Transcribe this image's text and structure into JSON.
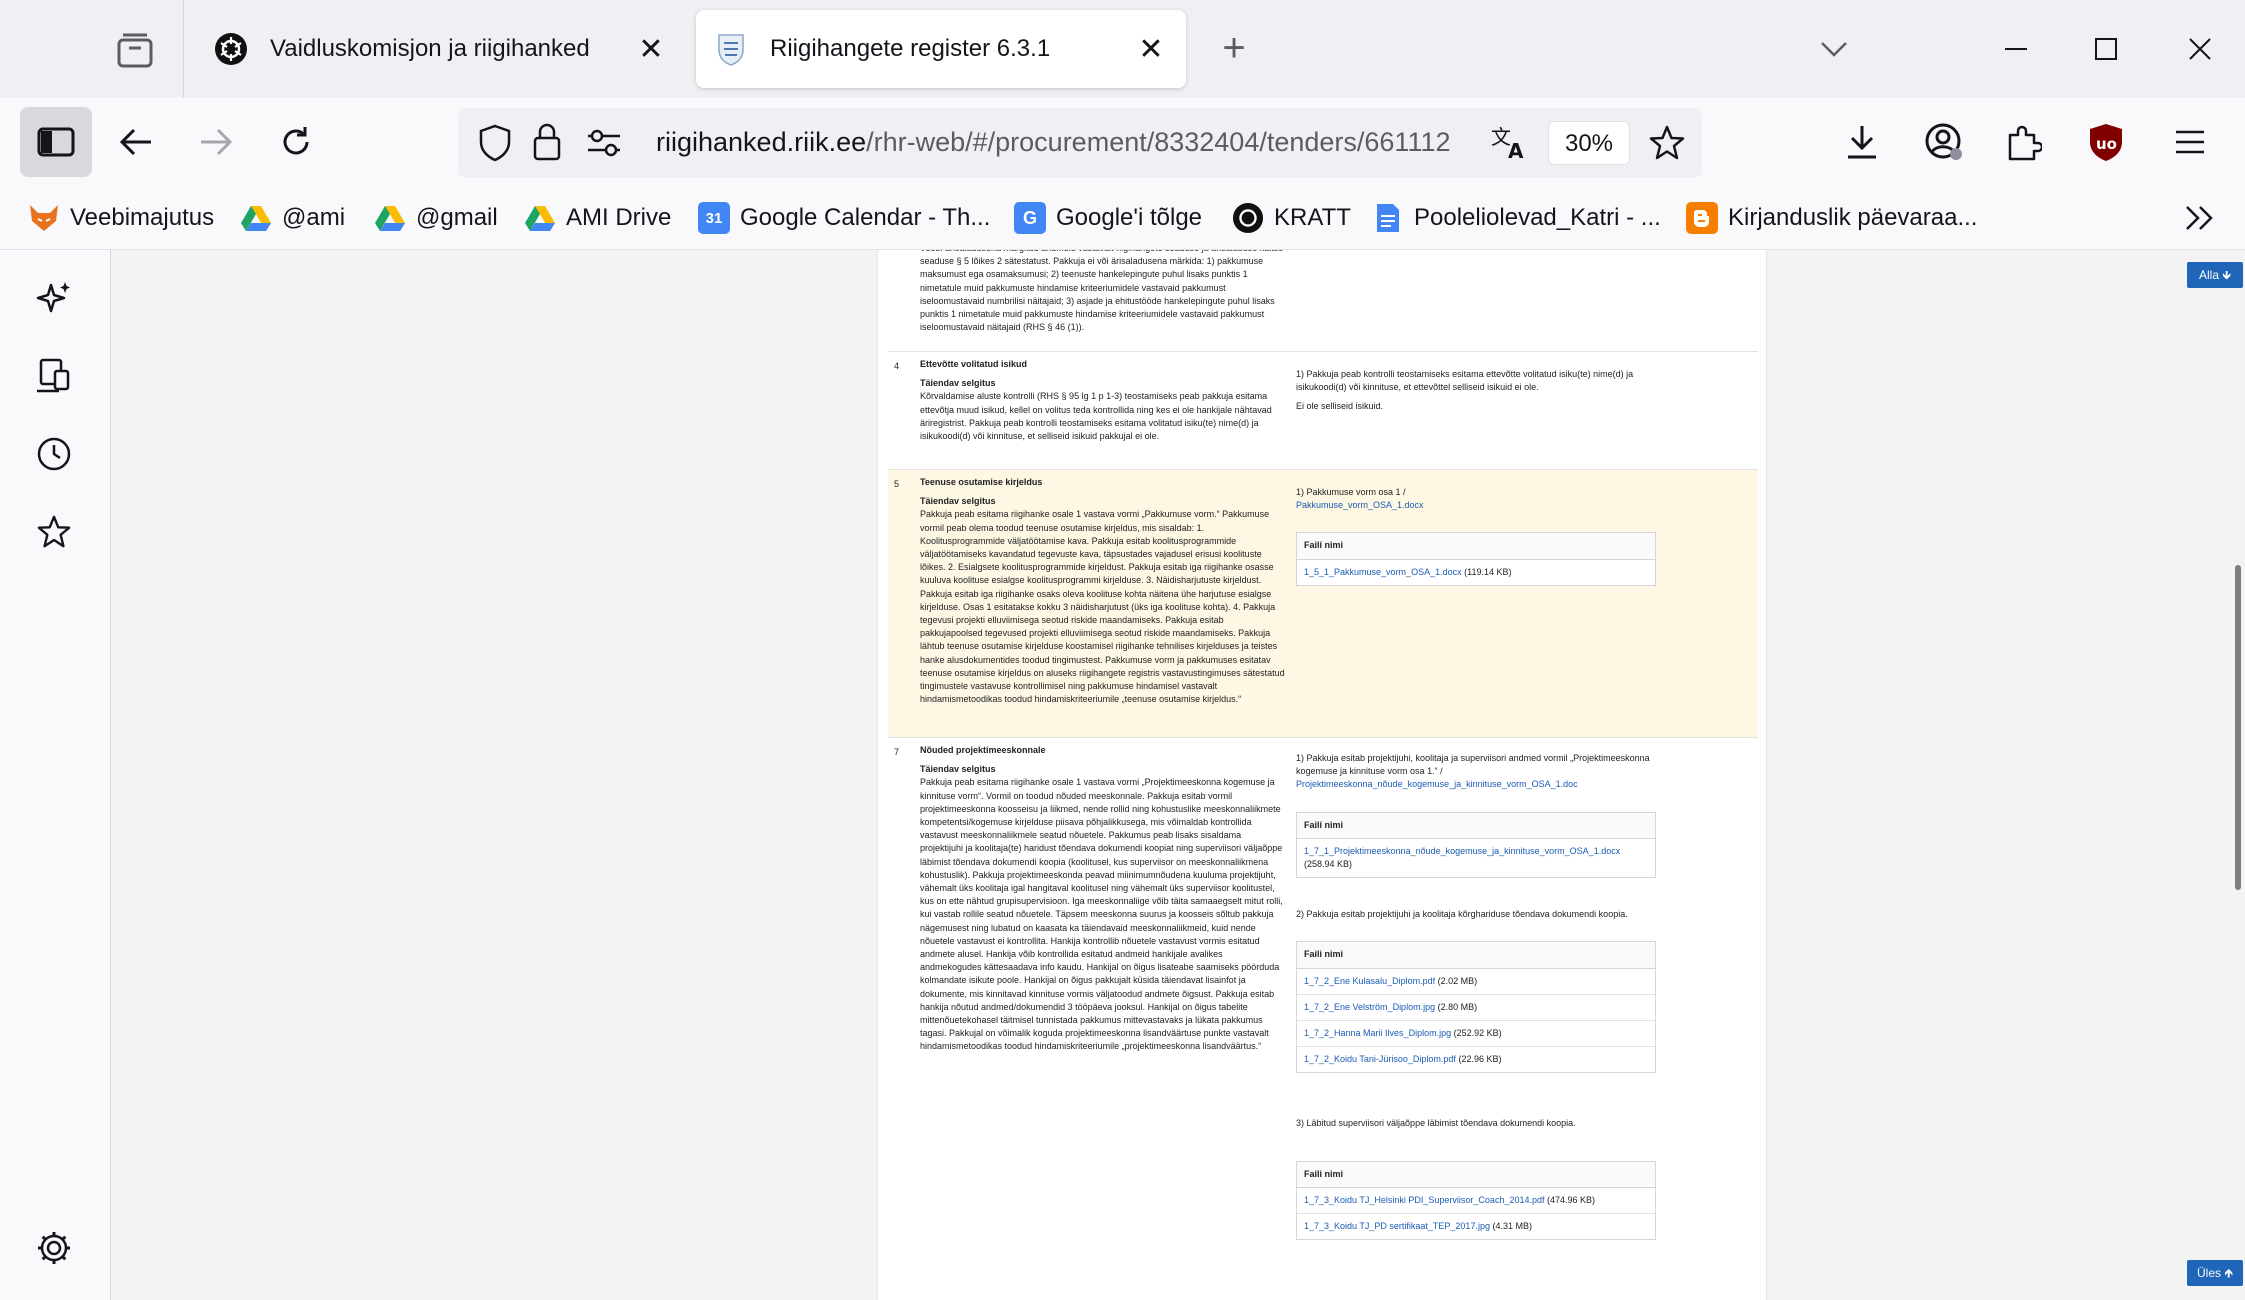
{
  "tabs": [
    {
      "title": "Vaidluskomisjon ja riigihanked",
      "icon": "openai-icon"
    },
    {
      "title": "Riigihangete register 6.3.1",
      "icon": "estonia-coat-of-arms-icon"
    }
  ],
  "urlbar": {
    "host": "riigihanked.riik.ee",
    "path": "/rhr-web/#/procurement/8332404/tenders/661112",
    "zoom": "30%"
  },
  "bookmarks": [
    {
      "label": "Veebimajutus",
      "icon": "fox-icon",
      "color": "#e8731c"
    },
    {
      "label": "@ami",
      "icon": "google-drive-icon",
      "color": "#1fa463"
    },
    {
      "label": "@gmail",
      "icon": "google-drive-icon",
      "color": "#1fa463"
    },
    {
      "label": "AMI Drive",
      "icon": "google-drive-icon",
      "color": "#1fa463"
    },
    {
      "label": "Google Calendar - Th...",
      "icon": "google-calendar-icon",
      "color": "#4285f4"
    },
    {
      "label": "Google'i tõlge",
      "icon": "google-translate-icon",
      "color": "#4285f4"
    },
    {
      "label": "KRATT",
      "icon": "openai-icon",
      "color": "#111111"
    },
    {
      "label": "Pooleliolevad_Katri - ...",
      "icon": "google-docs-icon",
      "color": "#4285f4"
    },
    {
      "label": "Kirjanduslik päevaraa...",
      "icon": "blogger-icon",
      "color": "#f57d00"
    }
  ],
  "page": {
    "down_button": "Alla 🡻",
    "up_button": "Üles 🡹"
  },
  "rows": {
    "top_fragment": "Veebi ärisaladusena märgitud andmeid vastavalt riigihangete seaduse ja ärisaladuse kaitse seaduse § 5 lõikes 2 sätestatust. Pakkuja ei või ärisaladusena märkida: 1) pakkumuse maksumust ega osamaksumusi; 2) teenuste hankelepingute puhul lisaks punktis 1 nimetatule muid pakkumuste hindamise kriteeriumidele vastavaid pakkumust iseloomustavaid numbrilisi näitajaid; 3) asjade ja ehitustööde hankelepingute puhul lisaks punktis 1 nimetatule muid pakkumuste hindamise kriteeriumidele vastavaid pakkumust iseloomustavaid näitajaid (RHS § 46 (1)).",
    "r4": {
      "num": "4",
      "title": "Ettevõtte volitatud isikud",
      "sub": "Täiendav selgitus",
      "text": "Kõrvaldamise aluste kontrolli (RHS § 95 lg 1 p 1-3) teostamiseks peab pakkuja esitama ettevõtja muud isikud, kellel on volitus teda kontrollida ning kes ei ole hankijale nähtavad äriregistrist. Pakkuja peab kontrolli teostamiseks esitama volitatud isiku(te) nime(d) ja isikukoodi(d) või kinnituse, et selliseid isikuid pakkujal ei ole.",
      "answer": "1) Pakkuja peab kontrolli teostamiseks esitama ettevõtte volitatud isiku(te) nime(d) ja isikukoodi(d) või kinnituse, et ettevõttel selliseid isikuid ei ole.",
      "answer2": "Ei ole selliseid isikuid."
    },
    "r5": {
      "num": "5",
      "title": "Teenuse osutamise kirjeldus",
      "sub": "Täiendav selgitus",
      "text": "Pakkuja peab esitama riigihanke osale 1 vastava vormi „Pakkumuse vorm.“ Pakkumuse vormil peab olema toodud teenuse osutamise kirjeldus, mis sisaldab: 1. Koolitusprogrammide väljatöötamise kava. Pakkuja esitab koolitusprogrammide väljatöötamiseks kavandatud tegevuste kava, täpsustades vajadusel erisusi koolituste lõikes. 2. Esialgsete koolitusprogrammide kirjeldust. Pakkuja esitab iga riigihanke osasse kuuluva koolituse esialgse koolitusprogrammi kirjelduse. 3. Näidisharjutuste kirjeldust. Pakkuja esitab iga riigihanke osaks oleva koolituse kohta näitena ühe harjutuse esialgse kirjelduse. Osas 1 esitatakse kokku 3 näidisharjutust (üks iga koolituse kohta). 4. Pakkuja tegevusi projekti elluviimisega seotud riskide maandamiseks. Pakkuja esitab pakkujapoolsed tegevused projekti elluviimisega seotud riskide maandamiseks. Pakkuja lähtub teenuse osutamise kirjelduse koostamisel riigihanke tehnilises kirjelduses ja teistes hanke alusdokumentides toodud tingimustest. Pakkumuse vorm ja pakkumuses esitatav teenuse osutamise kirjeldus on aluseks riigihangete registris vastavustingimuses sätestatud tingimustele vastavuse kontrollimisel ning pakkumuse hindamisel vastavalt hindamismetoodikas toodud hindamiskriteeriumile „teenuse osutamise kirjeldus.“",
      "answer": "1) Pakkumuse vorm osa 1 /",
      "answer_link": "Pakkumuse_vorm_OSA_1.docx",
      "file_header": "Faili nimi",
      "files": [
        {
          "name": "1_5_1_Pakkumuse_vorm_OSA_1.docx",
          "size": "(119.14 KB)"
        }
      ]
    },
    "r7": {
      "num": "7",
      "title": "Nõuded projektimeeskonnale",
      "sub": "Täiendav selgitus",
      "text": "Pakkuja peab esitama riigihanke osale 1 vastava vormi „Projektimeeskonna kogemuse ja kinnituse vorm“. Vormil on toodud nõuded meeskonnale. Pakkuja esitab vormil projektimeeskonna koosseisu ja liikmed, nende rollid ning kohustuslike meeskonnaliikmete kompetentsi/kogemuse kirjelduse piisava põhjalikkusega, mis võimaldab kontrollida vastavust meeskonnaliikmele seatud nõuetele. Pakkumus peab lisaks sisaldama projektijuhi ja koolitaja(te) haridust tõendava dokumendi koopiat ning superviisori väljaõppe läbimist tõendava dokumendi koopia (koolitusel, kus superviisor on meeskonnaliikmena kohustuslik). Pakkuja projektimeeskonda peavad miinimumnõudena kuuluma projektijuht, vähemalt üks koolitaja igal hangitaval koolitusel ning vähemalt üks superviisor koolitustel, kus on ette nähtud grupisupervisioon. Iga meeskonnaliige võib täita samaaegselt mitut rolli, kui vastab rollile seatud nõuetele. Täpsem meeskonna suurus ja koosseis sõltub pakkuja nägemusest ning lubatud on kaasata ka täiendavaid meeskonnaliikmeid, kuid nende nõuetele vastavust ei kontrollita. Hankija kontrollib nõuetele vastavust vormis esitatud andmete alusel. Hankija võib kontrollida esitatud andmeid hankijale avalikes andmekogudes kättesaadava info kaudu. Hankijal on õigus lisateabe saamiseks pöörduda kolmandate isikute poole. Hankijal on õigus pakkujalt küsida täiendavat lisainfot ja dokumente, mis kinnitavad kinnituse vormis väljatoodud andmete õigsust. Pakkuja esitab hankija nõutud andmed/dokumendid 3 tööpäeva jooksul. Hankijal on õigus tabelite mittenõuetekohasel täitmisel tunnistada pakkumus mittevastavaks ja lükata pakkumus tagasi. Pakkujal on võimalik koguda projektimeeskonna lisandväärtuse punkte vastavalt hindamismetoodikas toodud hindamiskriteeriumile „projektimeeskonna lisandväärtus.“",
      "answer1": "1) Pakkuja esitab projektijuhi, koolitaja ja superviisori andmed vormil „Projektimeeskonna kogemuse ja kinnituse vorm osa 1.“ /",
      "answer1_link": "Projektimeeskonna_nõude_kogemuse_ja_kinnituse_vorm_OSA_1.doc",
      "files1": [
        {
          "name": "1_7_1_Projektimeeskonna_nõude_kogemuse_ja_kinnituse_vorm_OSA_1.docx",
          "size": "(258.94 KB)"
        }
      ],
      "answer2": "2) Pakkuja esitab projektijuhi ja koolitaja kõrghariduse tõendava dokumendi koopia.",
      "files2": [
        {
          "name": "1_7_2_Ene Kulasalu_Diplom.pdf",
          "size": "(2.02 MB)"
        },
        {
          "name": "1_7_2_Ene Velström_Diplom.jpg",
          "size": "(2.80 MB)"
        },
        {
          "name": "1_7_2_Hanna Marii Ilves_Diplom.jpg",
          "size": "(252.92 KB)"
        },
        {
          "name": "1_7_2_Koidu Tani-Jürisoo_Diplom.pdf",
          "size": "(22.96 KB)"
        }
      ],
      "answer3": "3) Läbitud superviisori väljaõppe läbimist tõendava dokumendi koopia.",
      "files3": [
        {
          "name": "1_7_3_Koidu TJ_Helsinki PDI_Superviisor_Coach_2014.pdf",
          "size": "(474.96 KB)"
        },
        {
          "name": "1_7_3_Koidu TJ_PD sertifikaat_TEP_2017.jpg",
          "size": "(4.31 MB)"
        }
      ],
      "file_header": "Faili nimi"
    }
  }
}
